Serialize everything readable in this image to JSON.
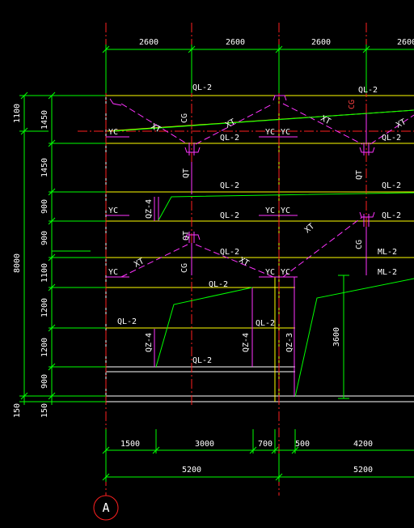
{
  "colors": {
    "background": "#000000",
    "dimension_line": "#00ff00",
    "dimension_text": "#ffffff",
    "axis_line": "#ff0000",
    "wall_line": "#ffff00",
    "member_line": "#ff00ff",
    "ramp_line": "#00ff00",
    "outline": "#ffffff"
  },
  "top_dimensions": [
    "2600",
    "2600",
    "2600",
    "2600"
  ],
  "left_outer_dimensions": [
    "1100",
    "8000",
    "150"
  ],
  "left_inner_dimensions": [
    "1450",
    "1450",
    "900",
    "900",
    "1100",
    "1200",
    "1200",
    "900",
    "150"
  ],
  "bottom_dimensions_row1": [
    "1500",
    "3000",
    "700",
    "500",
    "4200"
  ],
  "bottom_dimensions_row2": [
    "5200",
    "5200"
  ],
  "axis_label": "A",
  "member_labels": {
    "ql2": "QL-2",
    "ml2": "ML-2",
    "yc": "YC",
    "xt": "XT",
    "cg": "CG",
    "qt": "QT",
    "qz3": "QZ-3",
    "qz4": "QZ-4",
    "dim_3600": "3600"
  }
}
